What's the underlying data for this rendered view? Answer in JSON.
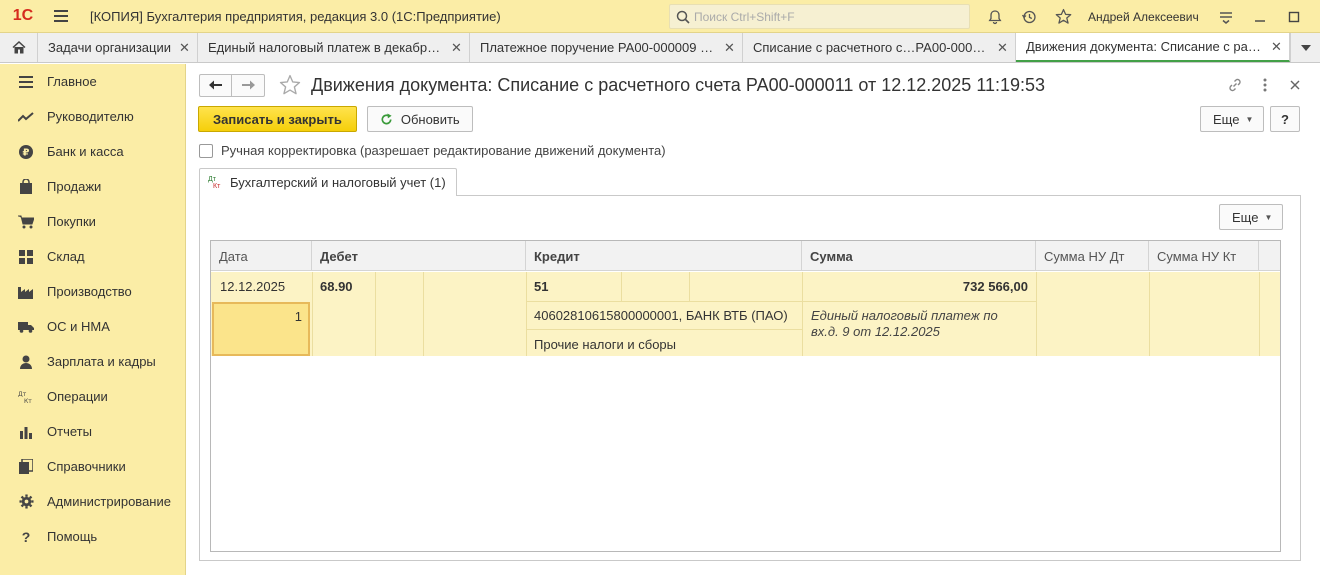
{
  "app": {
    "title": "[КОПИЯ] Бухгалтерия предприятия, редакция 3.0  (1С:Предприятие)",
    "logo_text": "1C",
    "search_placeholder": "Поиск Ctrl+Shift+F",
    "user": "Андрей Алексеевич"
  },
  "tabs": [
    {
      "label": "Задачи организации"
    },
    {
      "label": "Единый налоговый платеж в декабре…"
    },
    {
      "label": "Платежное поручение РА00-000009 о…"
    },
    {
      "label": "Списание с расчетного с…РА00-000011"
    },
    {
      "label": "Движения документа: Списание с ра…",
      "active": true
    }
  ],
  "sidebar": {
    "items": [
      {
        "label": "Главное",
        "icon": "menu-lines-icon"
      },
      {
        "label": "Руководителю",
        "icon": "trend-icon"
      },
      {
        "label": "Банк и касса",
        "icon": "ruble-coin-icon"
      },
      {
        "label": "Продажи",
        "icon": "shopping-bag-icon"
      },
      {
        "label": "Покупки",
        "icon": "cart-icon"
      },
      {
        "label": "Склад",
        "icon": "warehouse-grid-icon"
      },
      {
        "label": "Производство",
        "icon": "factory-icon"
      },
      {
        "label": "ОС и НМА",
        "icon": "truck-icon"
      },
      {
        "label": "Зарплата и кадры",
        "icon": "person-icon"
      },
      {
        "label": "Операции",
        "icon": "dt-kt-icon"
      },
      {
        "label": "Отчеты",
        "icon": "bar-chart-icon"
      },
      {
        "label": "Справочники",
        "icon": "books-icon"
      },
      {
        "label": "Администрирование",
        "icon": "gear-icon"
      },
      {
        "label": "Помощь",
        "icon": "question-icon"
      }
    ]
  },
  "document": {
    "title": "Движения документа: Списание с расчетного счета РА00-000011 от 12.12.2025 11:19:53",
    "save_close": "Записать и закрыть",
    "refresh": "Обновить",
    "more": "Еще",
    "help": "?",
    "manual_edit": "Ручная корректировка (разрешает редактирование движений документа)",
    "tab_label": "Бухгалтерский и налоговый учет (1)",
    "tab_icon_dt": "Дт",
    "tab_icon_kt": "Кт"
  },
  "grid": {
    "headers": [
      "Дата",
      "Дебет",
      "Кредит",
      "Сумма",
      "Сумма НУ Дт",
      "Сумма НУ Кт"
    ],
    "row": {
      "date": "12.12.2025",
      "line_no": "1",
      "debit_account": "68.90",
      "credit_account": "51",
      "credit_subconto1": "40602810615800000001, БАНК ВТБ (ПАО)",
      "credit_subconto2": "Прочие налоги и сборы",
      "amount": "732 566,00",
      "content_line1": "Единый налоговый платеж по",
      "content_line2": "вх.д. 9 от 12.12.2025"
    }
  }
}
